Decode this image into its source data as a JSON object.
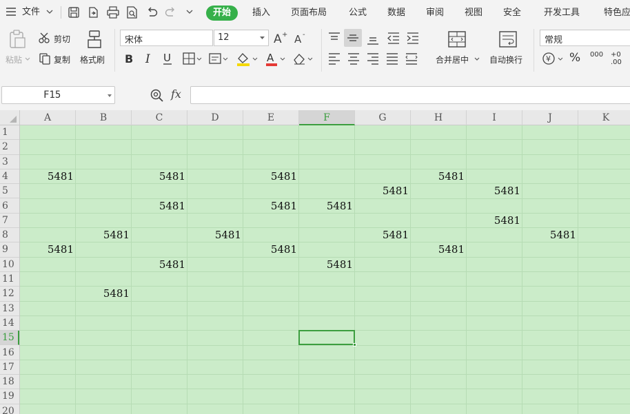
{
  "menu": {
    "file_label": "文件",
    "tabs": [
      "开始",
      "插入",
      "页面布局",
      "公式",
      "数据",
      "审阅",
      "视图",
      "安全",
      "开发工具",
      "特色应"
    ]
  },
  "toolbar": {
    "paste": "粘贴",
    "cut": "剪切",
    "copy": "复制",
    "format_painter": "格式刷",
    "font_name": "宋体",
    "font_size": "12",
    "merge_center": "合并居中",
    "wrap_text": "自动换行",
    "number_format": "常规",
    "percent": "%",
    "thousands": "000",
    "decimal": "+0 .00"
  },
  "formula": {
    "name_box": "F15",
    "fx": "fx",
    "content": ""
  },
  "sheet": {
    "columns": [
      "A",
      "B",
      "C",
      "D",
      "E",
      "F",
      "G",
      "H",
      "I",
      "J",
      "K"
    ],
    "rows": [
      "1",
      "2",
      "3",
      "4",
      "5",
      "6",
      "7",
      "8",
      "9",
      "10",
      "11",
      "12",
      "13",
      "14",
      "15",
      "16",
      "17",
      "18",
      "19",
      "20"
    ],
    "selected_cell": "F15",
    "cells": [
      {
        "ref": "A4",
        "value": "5481"
      },
      {
        "ref": "C4",
        "value": "5481"
      },
      {
        "ref": "E4",
        "value": "5481"
      },
      {
        "ref": "H4",
        "value": "5481"
      },
      {
        "ref": "G5",
        "value": "5481"
      },
      {
        "ref": "I5",
        "value": "5481"
      },
      {
        "ref": "C6",
        "value": "5481"
      },
      {
        "ref": "E6",
        "value": "5481"
      },
      {
        "ref": "F6",
        "value": "5481"
      },
      {
        "ref": "I7",
        "value": "5481"
      },
      {
        "ref": "B8",
        "value": "5481"
      },
      {
        "ref": "D8",
        "value": "5481"
      },
      {
        "ref": "G8",
        "value": "5481"
      },
      {
        "ref": "J8",
        "value": "5481"
      },
      {
        "ref": "A9",
        "value": "5481"
      },
      {
        "ref": "E9",
        "value": "5481"
      },
      {
        "ref": "H9",
        "value": "5481"
      },
      {
        "ref": "C10",
        "value": "5481"
      },
      {
        "ref": "F10",
        "value": "5481"
      },
      {
        "ref": "B12",
        "value": "5481"
      }
    ]
  },
  "colors": {
    "accent": "#36b04a",
    "grid_bg": "#cbecc9",
    "selection": "#3c9e3f"
  }
}
